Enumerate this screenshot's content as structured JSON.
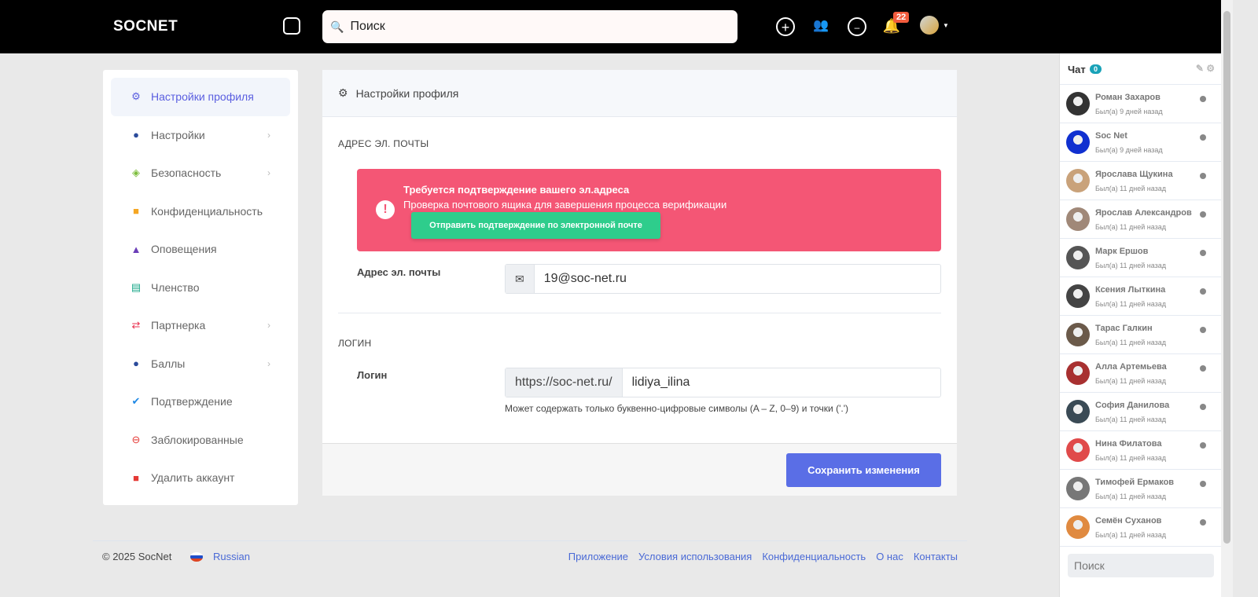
{
  "header": {
    "logo": "SOCNET",
    "search_placeholder": "Поиск",
    "notif_count": "22"
  },
  "sidebar": {
    "items": [
      {
        "label": "Настройки профиля",
        "icon": "gear-icon",
        "color": "#5a5ee0",
        "chev": false
      },
      {
        "label": "Настройки",
        "icon": "user-icon",
        "color": "#2b4b9b",
        "chev": true
      },
      {
        "label": "Безопасность",
        "icon": "shield-icon",
        "color": "#7cbd3b",
        "chev": true
      },
      {
        "label": "Конфиденциальность",
        "icon": "spy-icon",
        "color": "#f5a623",
        "chev": false
      },
      {
        "label": "Оповещения",
        "icon": "bell-icon",
        "color": "#6b3fb8",
        "chev": false
      },
      {
        "label": "Членство",
        "icon": "card-icon",
        "color": "#1aa88a",
        "chev": false
      },
      {
        "label": "Партнерка",
        "icon": "exchange-icon",
        "color": "#e8314f",
        "chev": true
      },
      {
        "label": "Баллы",
        "icon": "piggy-bank-icon",
        "color": "#2b4b9b",
        "chev": true
      },
      {
        "label": "Подтверждение",
        "icon": "check-circle-icon",
        "color": "#1e88e5",
        "chev": false
      },
      {
        "label": "Заблокированные",
        "icon": "minus-circle-icon",
        "color": "#e53935",
        "chev": false
      },
      {
        "label": "Удалить аккаунт",
        "icon": "trash-icon",
        "color": "#e53935",
        "chev": false
      }
    ]
  },
  "main": {
    "title": "Настройки профиля",
    "email_section": "АДРЕС ЭЛ. ПОЧТЫ",
    "alert": {
      "title": "Требуется подтверждение вашего эл.адреса",
      "text": "Проверка почтового ящика для завершения процесса верификации",
      "button": "Отправить подтверждение по электронной почте"
    },
    "email_label": "Адрес эл. почты",
    "email_value": "19@soc-net.ru",
    "login_section": "ЛОГИН",
    "login_label": "Логин",
    "login_prefix": "https://soc-net.ru/",
    "login_value": "lidiya_ilina",
    "login_help": "Может содержать только буквенно-цифровые символы (A – Z, 0–9) и точки ('.')",
    "save": "Сохранить изменения"
  },
  "footer": {
    "copyright": "© 2025 SocNet",
    "language": "Russian",
    "links": [
      "Приложение",
      "Условия использования",
      "Конфиденциальность",
      "О нас",
      "Контакты"
    ]
  },
  "chat": {
    "title": "Чат",
    "count": "0",
    "search_placeholder": "Поиск",
    "contacts": [
      {
        "name": "Роман Захаров",
        "status": "Был(а) 9 дней назад"
      },
      {
        "name": "Soc Net",
        "status": "Был(а) 9 дней назад"
      },
      {
        "name": "Ярослава Щукина",
        "status": "Был(а) 11 дней назад"
      },
      {
        "name": "Ярослав Александров",
        "status": "Был(а) 11 дней назад"
      },
      {
        "name": "Марк Ершов",
        "status": "Был(а) 11 дней назад"
      },
      {
        "name": "Ксения Лыткина",
        "status": "Был(а) 11 дней назад"
      },
      {
        "name": "Тарас Галкин",
        "status": "Был(а) 11 дней назад"
      },
      {
        "name": "Алла Артемьева",
        "status": "Был(а) 11 дней назад"
      },
      {
        "name": "София Данилова",
        "status": "Был(а) 11 дней назад"
      },
      {
        "name": "Нина Филатова",
        "status": "Был(а) 11 дней назад"
      },
      {
        "name": "Тимофей Ермаков",
        "status": "Был(а) 11 дней назад"
      },
      {
        "name": "Семён Суханов",
        "status": "Был(а) 11 дней назад"
      }
    ]
  }
}
